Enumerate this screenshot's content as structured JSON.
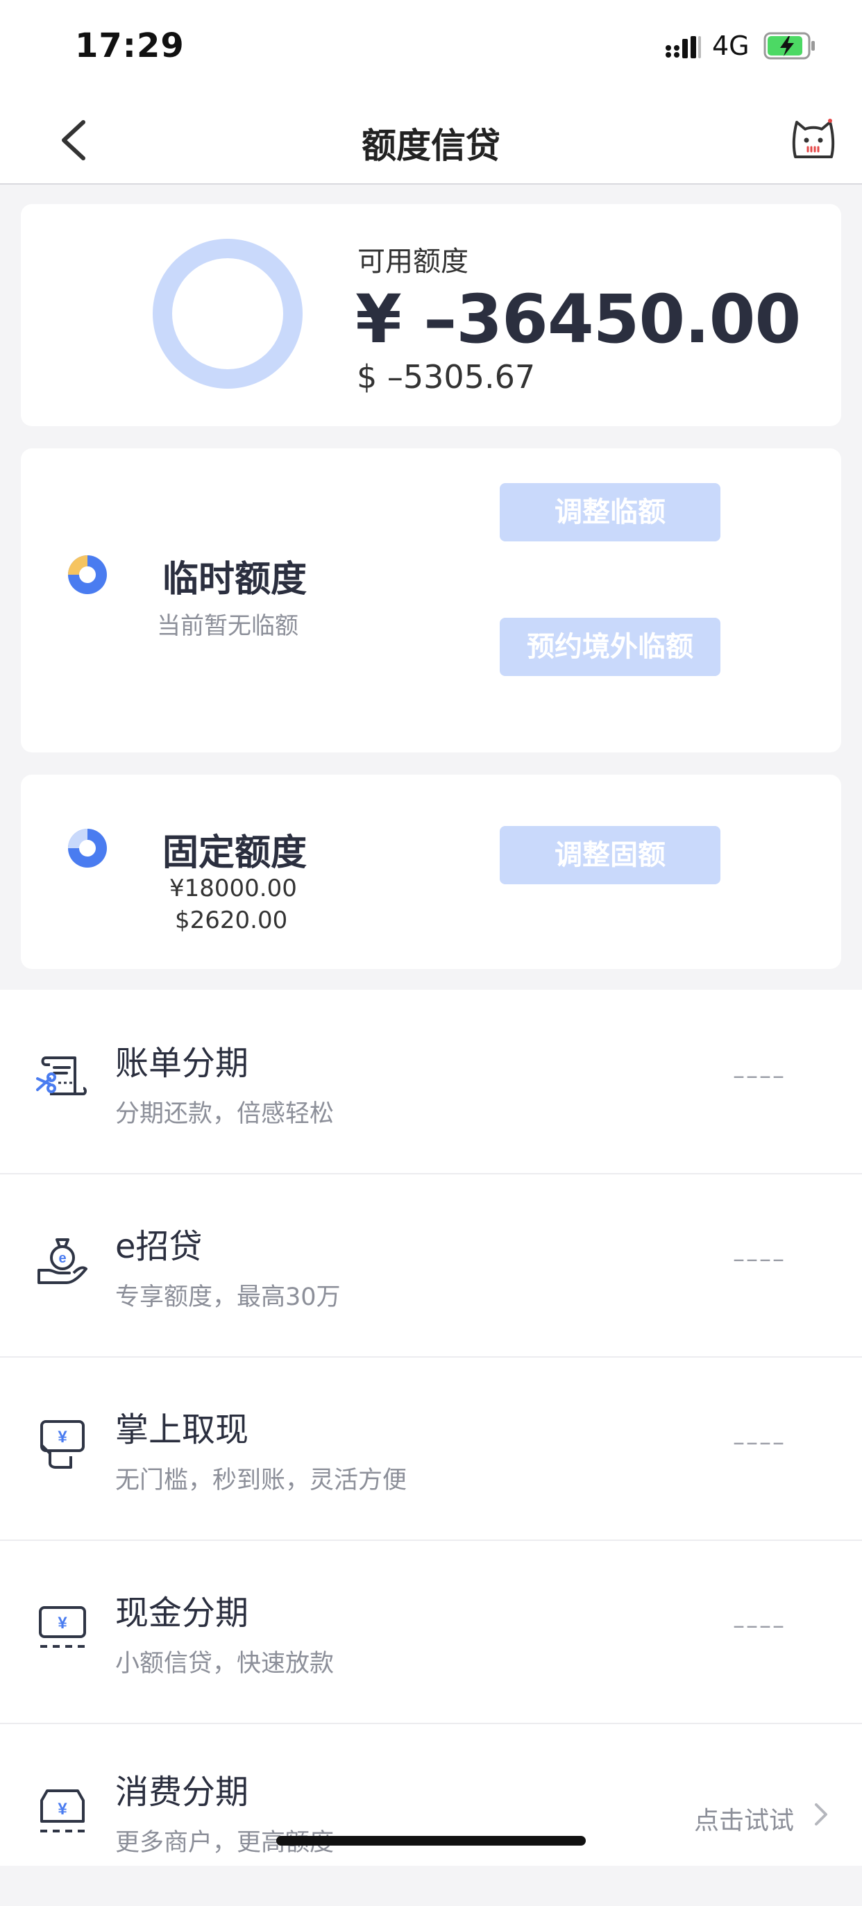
{
  "status_bar": {
    "time": "17:29",
    "network": "4G"
  },
  "nav": {
    "title": "额度信贷"
  },
  "available": {
    "label": "可用额度",
    "cny": "¥ –36450.00",
    "usd": "$ –5305.67"
  },
  "temporary": {
    "title": "临时额度",
    "subtitle": "当前暂无临额",
    "adjust_button": "调整临额",
    "reserve_button": "预约境外临额"
  },
  "fixed": {
    "title": "固定额度",
    "cny": "¥18000.00",
    "usd": "$2620.00",
    "adjust_button": "调整固额"
  },
  "list": [
    {
      "title": "账单分期",
      "desc": "分期还款，倍感轻松",
      "right": "––––",
      "icon": "bill-installment-icon"
    },
    {
      "title": "e招贷",
      "desc": "专享额度，最高30万",
      "right": "––––",
      "icon": "money-bag-icon"
    },
    {
      "title": "掌上取现",
      "desc": "无门槛，秒到账，灵活方便",
      "right": "––––",
      "icon": "cash-withdraw-icon"
    },
    {
      "title": "现金分期",
      "desc": "小额信贷，快速放款",
      "right": "––––",
      "icon": "cash-installment-icon"
    },
    {
      "title": "消费分期",
      "desc": "更多商户，更高额度",
      "right": "点击试试",
      "icon": "consume-installment-icon"
    }
  ],
  "colors": {
    "accent": "#4a7cf0",
    "button_bg": "#c9d9fb",
    "ring": "#c9d9fb",
    "pie_yellow": "#f6c460",
    "text_dark": "#2b2f3f",
    "text_muted": "#8c8f99"
  }
}
